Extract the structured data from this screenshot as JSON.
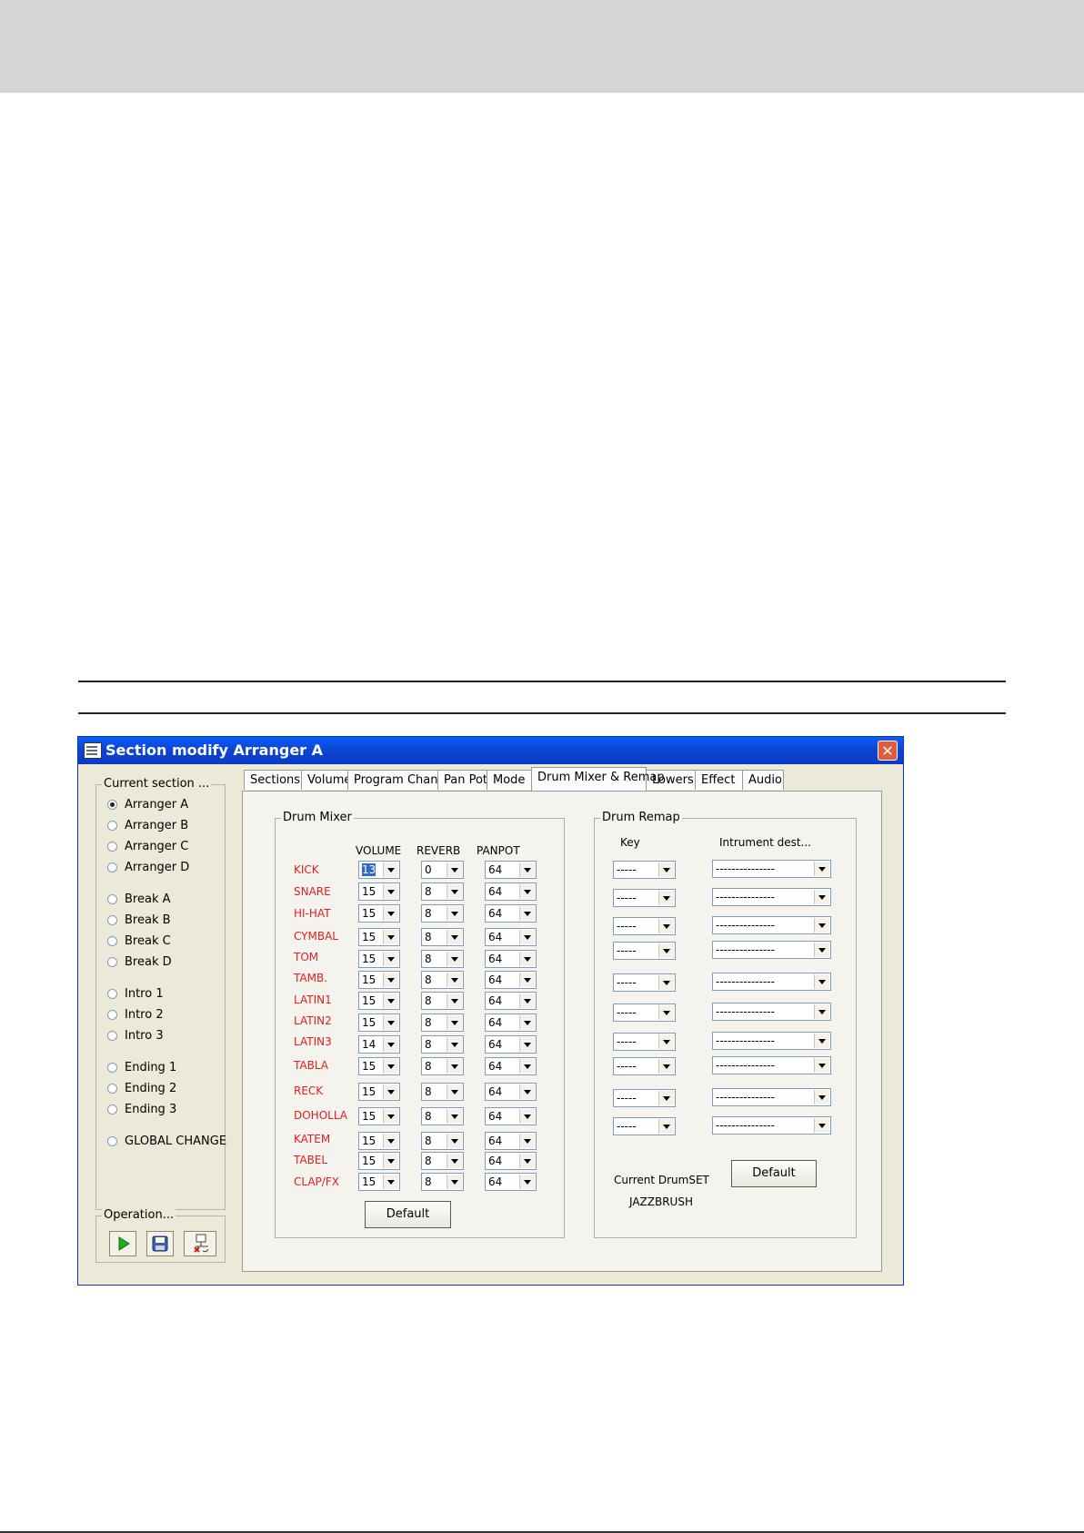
{
  "window": {
    "title": "Section modify Arranger A",
    "close": "✕"
  },
  "current_section": {
    "label": "Current section ...",
    "items": [
      {
        "label": "Arranger A",
        "selected": true
      },
      {
        "label": "Arranger B",
        "selected": false
      },
      {
        "label": "Arranger C",
        "selected": false
      },
      {
        "label": "Arranger D",
        "selected": false
      },
      {
        "label": "Break A",
        "selected": false
      },
      {
        "label": "Break B",
        "selected": false
      },
      {
        "label": "Break C",
        "selected": false
      },
      {
        "label": "Break D",
        "selected": false
      },
      {
        "label": "Intro 1",
        "selected": false
      },
      {
        "label": "Intro 2",
        "selected": false
      },
      {
        "label": "Intro 3",
        "selected": false
      },
      {
        "label": "Ending 1",
        "selected": false
      },
      {
        "label": "Ending 2",
        "selected": false
      },
      {
        "label": "Ending 3",
        "selected": false
      },
      {
        "label": "GLOBAL CHANGE",
        "selected": false
      }
    ]
  },
  "operation": {
    "label": "Operation...",
    "buttons": [
      "play-icon",
      "save-icon",
      "delete-icon"
    ]
  },
  "tabs": [
    "Sections",
    "Volumes",
    "Program Change",
    "Pan Pot",
    "Mode",
    "Drum Mixer & Remap",
    "Lowers",
    "Effect",
    "Audio"
  ],
  "active_tab": "Drum Mixer & Remap",
  "drum_mixer": {
    "label": "Drum Mixer",
    "headers": [
      "VOLUME",
      "REVERB",
      "PANPOT"
    ],
    "rows": [
      {
        "name": "KICK",
        "volume": "13",
        "reverb": "0",
        "panpot": "64"
      },
      {
        "name": "SNARE",
        "volume": "15",
        "reverb": "8",
        "panpot": "64"
      },
      {
        "name": "HI-HAT",
        "volume": "15",
        "reverb": "8",
        "panpot": "64"
      },
      {
        "name": "CYMBAL",
        "volume": "15",
        "reverb": "8",
        "panpot": "64"
      },
      {
        "name": "TOM",
        "volume": "15",
        "reverb": "8",
        "panpot": "64"
      },
      {
        "name": "TAMB.",
        "volume": "15",
        "reverb": "8",
        "panpot": "64"
      },
      {
        "name": "LATIN1",
        "volume": "15",
        "reverb": "8",
        "panpot": "64"
      },
      {
        "name": "LATIN2",
        "volume": "15",
        "reverb": "8",
        "panpot": "64"
      },
      {
        "name": "LATIN3",
        "volume": "14",
        "reverb": "8",
        "panpot": "64"
      },
      {
        "name": "TABLA",
        "volume": "15",
        "reverb": "8",
        "panpot": "64"
      },
      {
        "name": "RECK",
        "volume": "15",
        "reverb": "8",
        "panpot": "64"
      },
      {
        "name": "DOHOLLA",
        "volume": "15",
        "reverb": "8",
        "panpot": "64"
      },
      {
        "name": "KATEM",
        "volume": "15",
        "reverb": "8",
        "panpot": "64"
      },
      {
        "name": "TABEL",
        "volume": "15",
        "reverb": "8",
        "panpot": "64"
      },
      {
        "name": "CLAP/FX",
        "volume": "15",
        "reverb": "8",
        "panpot": "64"
      }
    ],
    "default_label": "Default"
  },
  "drum_remap": {
    "label": "Drum Remap",
    "headers": [
      "Key",
      "Intrument dest..."
    ],
    "rows": [
      {
        "key": "-----",
        "dest": "---------------"
      },
      {
        "key": "-----",
        "dest": "---------------"
      },
      {
        "key": "-----",
        "dest": "---------------"
      },
      {
        "key": "-----",
        "dest": "---------------"
      },
      {
        "key": "-----",
        "dest": "---------------"
      },
      {
        "key": "-----",
        "dest": "---------------"
      },
      {
        "key": "-----",
        "dest": "---------------"
      },
      {
        "key": "-----",
        "dest": "---------------"
      },
      {
        "key": "-----",
        "dest": "---------------"
      },
      {
        "key": "-----",
        "dest": "---------------"
      }
    ],
    "current_label": "Current DrumSET",
    "current_value": "JAZZBRUSH",
    "default_label": "Default"
  },
  "colors": {
    "title_bar": "#0c45d6",
    "instrument_text": "#e11e1e",
    "window_bg": "#ece9d8"
  }
}
